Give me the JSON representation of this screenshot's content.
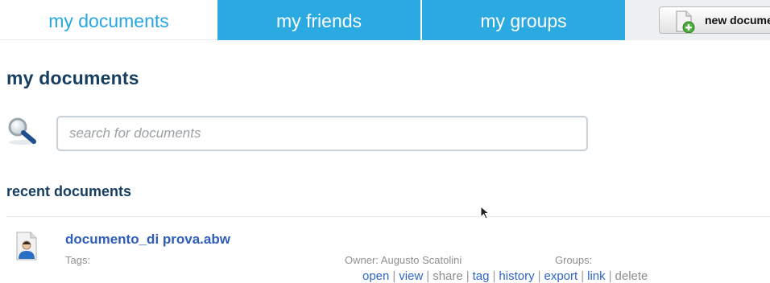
{
  "tabs": {
    "my_documents": "my documents",
    "my_friends": "my friends",
    "my_groups": "my groups"
  },
  "toolbar": {
    "new_document_label": "new document",
    "new_document_icon": "new-document-icon"
  },
  "page": {
    "title": "my documents"
  },
  "search": {
    "placeholder": "search for documents",
    "value": "",
    "icon": "magnifier-icon"
  },
  "recent": {
    "title": "recent documents",
    "documents": [
      {
        "name": "documento_di prova.abw",
        "icon": "user-document-icon",
        "tags_label": "Tags:",
        "owner_label": "Owner: Augusto Scatolini",
        "groups_label": "Groups:",
        "actions": {
          "open": "open",
          "view": "view",
          "share": "share",
          "tag": "tag",
          "history": "history",
          "export": "export",
          "link": "link",
          "delete": "delete",
          "separator": "|"
        }
      }
    ]
  },
  "colors": {
    "accent": "#2baae2",
    "active_tab_text": "#27a7e0",
    "heading": "#163e61",
    "link": "#2e64c8",
    "muted": "#8f8f8f"
  }
}
